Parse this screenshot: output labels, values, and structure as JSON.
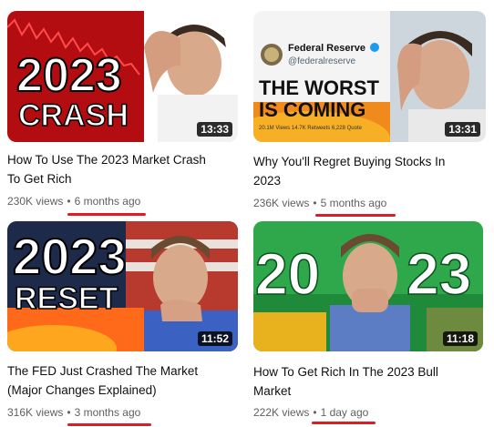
{
  "videos": [
    {
      "thumb_big_text": "2023",
      "thumb_small_text": "CRASH",
      "duration": "13:33",
      "title_line1": "How To Use The 2023 Market Crash",
      "title_line2": "To Get Rich",
      "views": "230K views",
      "age": "6 months ago"
    },
    {
      "tweet_name": "Federal Reserve",
      "tweet_handle": "@federalreserve",
      "thumb_text_line1": "THE WORST",
      "thumb_text_line2": "IS COMING",
      "tweet_stats": "20.1M Views   14.7K Retweets   6,228 Quote",
      "duration": "13:31",
      "title_line1": "Why You'll Regret Buying Stocks In",
      "title_line2": "2023",
      "views": "236K views",
      "age": "5 months ago"
    },
    {
      "thumb_big_text": "2023",
      "thumb_small_text": "RESET",
      "duration": "11:52",
      "title_line1": "The FED Just Crashed The Market",
      "title_line2": "(Major Changes Explained)",
      "views": "316K views",
      "age": "3 months ago"
    },
    {
      "thumb_left_text": "20",
      "thumb_right_text": "23",
      "duration": "11:18",
      "title_line1": "How To Get Rich In The 2023 Bull",
      "title_line2": "Market",
      "views": "222K views",
      "age": "1 day ago"
    }
  ],
  "separator": "•",
  "colors": {
    "underline": "#e01b24",
    "meta": "#606060",
    "title": "#0f0f0f"
  }
}
